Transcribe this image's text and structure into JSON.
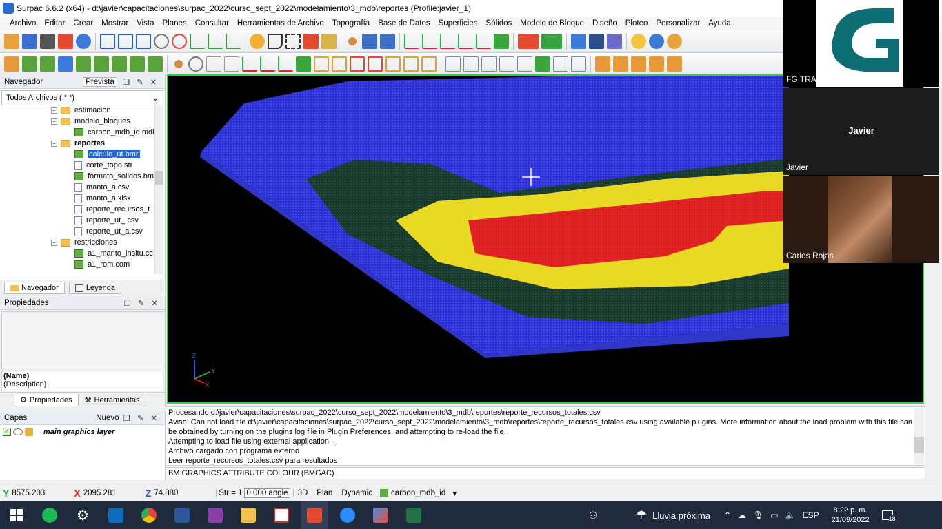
{
  "window": {
    "title": "Surpac 6.6.2 (x64) - d:\\javier\\capacitaciones\\surpac_2022\\curso_sept_2022\\modelamiento\\3_mdb\\reportes (Profile:javier_1)"
  },
  "menu": [
    "Archivo",
    "Editar",
    "Crear",
    "Mostrar",
    "Vista",
    "Planes",
    "Consultar",
    "Herramientas de Archivo",
    "Topografía",
    "Base de Datos",
    "Superficies",
    "Sólidos",
    "Modelo de Bloque",
    "Diseño",
    "Ploteo",
    "Personalizar",
    "Ayuda"
  ],
  "navigator": {
    "title": "Navegador",
    "preview": "Prevista",
    "filter": "Todos Archivos (.*.*)",
    "tree": [
      {
        "label": "estimacion",
        "type": "folder",
        "indent": 1,
        "expand": "+"
      },
      {
        "label": "modelo_bloques",
        "type": "folder",
        "indent": 1,
        "expand": "−"
      },
      {
        "label": "carbon_mdb_id.mdl",
        "type": "cube",
        "indent": 2,
        "expand": ""
      },
      {
        "label": "reportes",
        "type": "folder",
        "indent": 1,
        "expand": "−",
        "bold": true
      },
      {
        "label": "calculo_ut.bmr",
        "type": "cube",
        "indent": 2,
        "expand": "",
        "selected": true
      },
      {
        "label": "corte_topo.str",
        "type": "file",
        "indent": 2,
        "expand": ""
      },
      {
        "label": "formato_solidos.bmr",
        "type": "cube",
        "indent": 2,
        "expand": ""
      },
      {
        "label": "manto_a.csv",
        "type": "file",
        "indent": 2,
        "expand": ""
      },
      {
        "label": "manto_a.xlsx",
        "type": "file",
        "indent": 2,
        "expand": ""
      },
      {
        "label": "reporte_recursos_t",
        "type": "file",
        "indent": 2,
        "expand": ""
      },
      {
        "label": "reporte_ut_.csv",
        "type": "file",
        "indent": 2,
        "expand": ""
      },
      {
        "label": "reporte_ut_a.csv",
        "type": "file",
        "indent": 2,
        "expand": ""
      },
      {
        "label": "restricciones",
        "type": "folder",
        "indent": 1,
        "expand": "−"
      },
      {
        "label": "a1_manto_insitu.cc",
        "type": "cube",
        "indent": 2,
        "expand": ""
      },
      {
        "label": "a1_rom.com",
        "type": "cube",
        "indent": 2,
        "expand": ""
      }
    ],
    "tab_nav": "Navegador",
    "tab_legend": "Leyenda"
  },
  "properties": {
    "title": "Propiedades",
    "name": "(Name)",
    "description": "(Description)",
    "tab_props": "Propiedades",
    "tab_tools": "Herramientas"
  },
  "layers": {
    "title": "Capas",
    "new": "Nuevo",
    "layer": "main graphics layer"
  },
  "viewport": {
    "axis_z": "Z",
    "axis_y": "Y",
    "axis_x": "X"
  },
  "console": {
    "lines": [
      "Procesando d:\\javier\\capacitaciones\\surpac_2022\\curso_sept_2022\\modelamiento\\3_mdb\\reportes\\reporte_recursos_totales.csv",
      "Aviso: Can not load file d:\\javier\\capacitaciones\\surpac_2022\\curso_sept_2022\\modelamiento\\3_mdb\\reportes\\reporte_recursos_totales.csv using available plugins.  More information about the load problem with this file can",
      "be obtained by turning on the plugins log file in Plugin Preferences, and attempting to re-load the file.",
      "Attempting to load file using external application...",
      "Archivo cargado con programa externo",
      "Leer reporte_recursos_totales.csv para resultados"
    ],
    "command": "BM GRAPHICS ATTRIBUTE COLOUR (BMGAC)"
  },
  "status": {
    "y": "8575.203",
    "x": "2095.281",
    "z": "74.880",
    "str_label": "Str = 1",
    "angle": "0.000 angle",
    "mode3d": "3D",
    "plan": "Plan",
    "dynamic": "Dynamic",
    "model": "carbon_mdb_id"
  },
  "video": {
    "org": "FG TRAINING COLOMBIA",
    "p2_center": "Javier",
    "p2_name": "Javier",
    "p3_name": "Carlos Rojas"
  },
  "taskbar": {
    "weather": "Lluvia próxima",
    "lang": "ESP",
    "time": "8:22 p. m.",
    "date": "21/09/2022",
    "notif": "18"
  },
  "colors": {
    "viewport_border": "#3ec94a",
    "block_blue": "#2a2fd6",
    "block_yellow": "#e8d820",
    "block_red": "#e02020",
    "selection": "#1f64d8"
  }
}
